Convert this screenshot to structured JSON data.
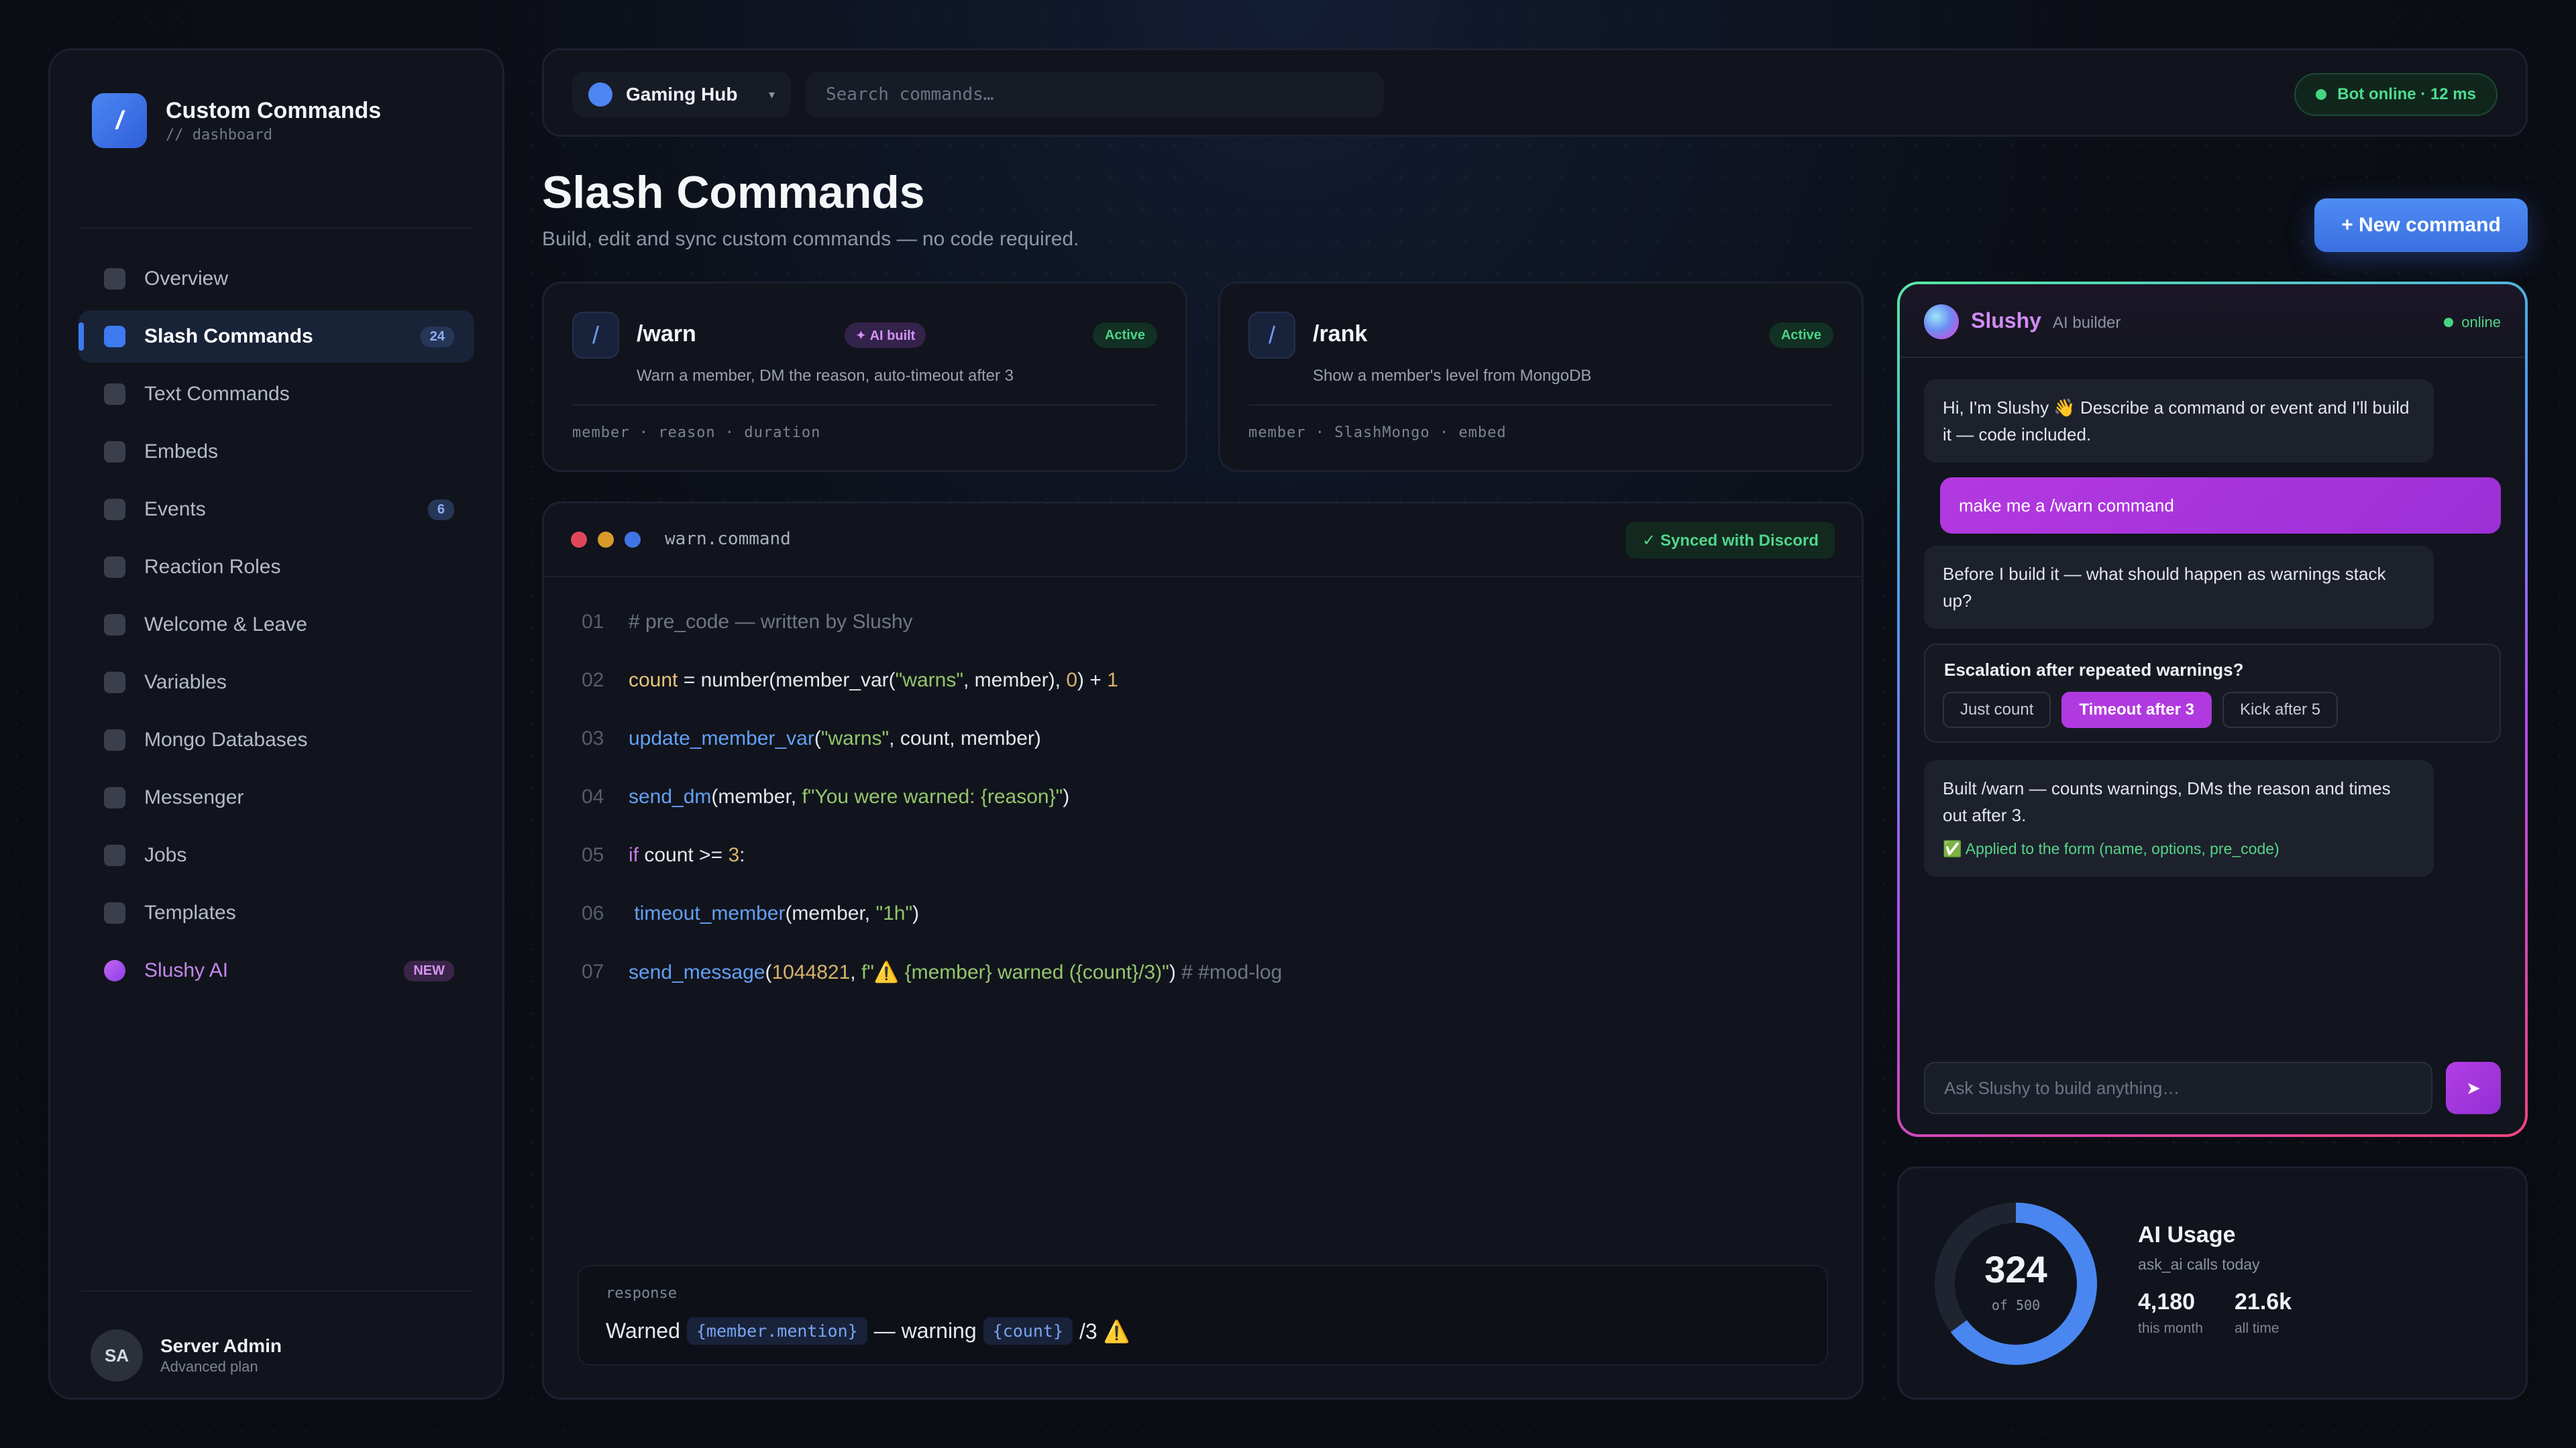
{
  "brand": {
    "logo": "/",
    "title": "Custom Commands",
    "subtitle": "// dashboard"
  },
  "sidebar": {
    "items": [
      {
        "label": "Overview",
        "badge": ""
      },
      {
        "label": "Slash Commands",
        "badge": "24",
        "active": true
      },
      {
        "label": "Text Commands",
        "badge": ""
      },
      {
        "label": "Embeds",
        "badge": ""
      },
      {
        "label": "Events",
        "badge": "6"
      },
      {
        "label": "Reaction Roles",
        "badge": ""
      },
      {
        "label": "Welcome & Leave",
        "badge": ""
      },
      {
        "label": "Variables",
        "badge": ""
      },
      {
        "label": "Mongo Databases",
        "badge": ""
      },
      {
        "label": "Messenger",
        "badge": ""
      },
      {
        "label": "Jobs",
        "badge": ""
      },
      {
        "label": "Templates",
        "badge": ""
      },
      {
        "label": "Slushy AI",
        "badge": "NEW"
      }
    ],
    "user": {
      "initials": "SA",
      "name": "Server Admin",
      "plan": "Advanced plan"
    }
  },
  "topbar": {
    "server": "Gaming Hub",
    "chevron": "▾",
    "search_placeholder": "Search commands…",
    "status": "Bot online · 12 ms"
  },
  "header": {
    "title": "Slash Commands",
    "subtitle": "Build, edit and sync custom commands — no code required.",
    "new_button": "+ New command"
  },
  "commands": [
    {
      "icon": "/",
      "name": "/warn",
      "ai_badge": "✦ AI built",
      "status": "Active",
      "description": "Warn a member, DM the reason, auto-timeout after 3",
      "options": "member · reason · duration"
    },
    {
      "icon": "/",
      "name": "/rank",
      "status": "Active",
      "description": "Show a member's level from MongoDB",
      "options": "member · SlashMongo · embed"
    }
  ],
  "editor": {
    "file": "warn.command",
    "synced": "✓ Synced with Discord",
    "line_numbers": [
      "01",
      "02",
      "03",
      "04",
      "05",
      "06",
      "07"
    ],
    "response_label": "response",
    "response": {
      "pre": "Warned",
      "chip1": "{member.mention}",
      "mid": "— warning",
      "chip2": "{count}",
      "post": "/3 ⚠️"
    }
  },
  "chat": {
    "name": "Slushy",
    "role": "AI builder",
    "status": "online",
    "messages": {
      "greeting": "Hi, I'm Slushy 👋 Describe a command or event and I'll build it — code included.",
      "user": "make me a /warn command",
      "question": "Before I build it — what should happen as warnings stack up?",
      "result": "Built /warn — counts warnings, DMs the reason and times out after 3.",
      "applied": "✅ Applied to the form (name, options, pre_code)"
    },
    "choice_title": "Escalation after repeated warnings?",
    "choices": [
      "Just count",
      "Timeout after 3",
      "Kick after 5"
    ],
    "input_placeholder": "Ask Slushy to build anything…",
    "send": "➤"
  },
  "usage": {
    "title": "AI Usage",
    "subtitle": "ask_ai calls today",
    "used": "324",
    "limit_text": "of 500",
    "fraction": 0.648,
    "month_value": "4,180",
    "month_label": "this month",
    "all_value": "21.6k",
    "all_label": "all time"
  }
}
